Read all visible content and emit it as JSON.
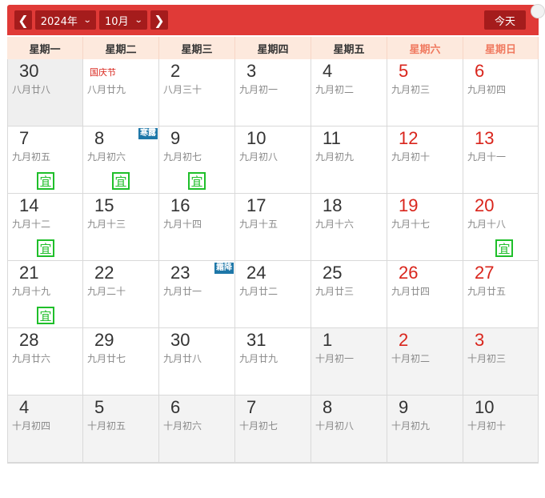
{
  "header": {
    "prev_icon": "chevron-left-icon",
    "next_icon": "chevron-right-icon",
    "year_value": "2024年",
    "month_value": "10月",
    "today_label": "今天"
  },
  "weekdays": [
    "星期一",
    "星期二",
    "星期三",
    "星期四",
    "星期五",
    "星期六",
    "星期日"
  ],
  "colors": {
    "header_bg": "#e03a37",
    "button_bg": "#a51c1c",
    "weekend_red": "#d9251c",
    "yi_green": "#1fbf2a",
    "term_blue": "#1e77a8"
  },
  "weeks": [
    [
      {
        "day": "30",
        "lunar": "八月廿八",
        "red": false,
        "month": "prev",
        "fest": "",
        "yi": false,
        "term": "",
        "gray": true
      },
      {
        "day": "",
        "lunar": "八月廿九",
        "red": false,
        "month": "cur",
        "fest": "国庆节",
        "yi": false,
        "term": ""
      },
      {
        "day": "2",
        "lunar": "八月三十",
        "red": false,
        "month": "cur",
        "fest": "",
        "yi": false,
        "term": ""
      },
      {
        "day": "3",
        "lunar": "九月初一",
        "red": false,
        "month": "cur",
        "fest": "",
        "yi": false,
        "term": ""
      },
      {
        "day": "4",
        "lunar": "九月初二",
        "red": false,
        "month": "cur",
        "fest": "",
        "yi": false,
        "term": ""
      },
      {
        "day": "5",
        "lunar": "九月初三",
        "red": true,
        "month": "cur",
        "fest": "",
        "yi": false,
        "term": ""
      },
      {
        "day": "6",
        "lunar": "九月初四",
        "red": true,
        "month": "cur",
        "fest": "",
        "yi": false,
        "term": ""
      }
    ],
    [
      {
        "day": "7",
        "lunar": "九月初五",
        "red": false,
        "month": "cur",
        "fest": "",
        "yi": true,
        "term": ""
      },
      {
        "day": "8",
        "lunar": "九月初六",
        "red": false,
        "month": "cur",
        "fest": "",
        "yi": true,
        "term": "寒露"
      },
      {
        "day": "9",
        "lunar": "九月初七",
        "red": false,
        "month": "cur",
        "fest": "",
        "yi": true,
        "term": ""
      },
      {
        "day": "10",
        "lunar": "九月初八",
        "red": false,
        "month": "cur",
        "fest": "",
        "yi": false,
        "term": ""
      },
      {
        "day": "11",
        "lunar": "九月初九",
        "red": false,
        "month": "cur",
        "fest": "",
        "yi": false,
        "term": ""
      },
      {
        "day": "12",
        "lunar": "九月初十",
        "red": true,
        "month": "cur",
        "fest": "",
        "yi": false,
        "term": ""
      },
      {
        "day": "13",
        "lunar": "九月十一",
        "red": true,
        "month": "cur",
        "fest": "",
        "yi": false,
        "term": ""
      }
    ],
    [
      {
        "day": "14",
        "lunar": "九月十二",
        "red": false,
        "month": "cur",
        "fest": "",
        "yi": true,
        "term": ""
      },
      {
        "day": "15",
        "lunar": "九月十三",
        "red": false,
        "month": "cur",
        "fest": "",
        "yi": false,
        "term": ""
      },
      {
        "day": "16",
        "lunar": "九月十四",
        "red": false,
        "month": "cur",
        "fest": "",
        "yi": false,
        "term": ""
      },
      {
        "day": "17",
        "lunar": "九月十五",
        "red": false,
        "month": "cur",
        "fest": "",
        "yi": false,
        "term": ""
      },
      {
        "day": "18",
        "lunar": "九月十六",
        "red": false,
        "month": "cur",
        "fest": "",
        "yi": false,
        "term": ""
      },
      {
        "day": "19",
        "lunar": "九月十七",
        "red": true,
        "month": "cur",
        "fest": "",
        "yi": false,
        "term": ""
      },
      {
        "day": "20",
        "lunar": "九月十八",
        "red": true,
        "month": "cur",
        "fest": "",
        "yi": true,
        "term": ""
      }
    ],
    [
      {
        "day": "21",
        "lunar": "九月十九",
        "red": false,
        "month": "cur",
        "fest": "",
        "yi": true,
        "term": ""
      },
      {
        "day": "22",
        "lunar": "九月二十",
        "red": false,
        "month": "cur",
        "fest": "",
        "yi": false,
        "term": ""
      },
      {
        "day": "23",
        "lunar": "九月廿一",
        "red": false,
        "month": "cur",
        "fest": "",
        "yi": false,
        "term": "霜降"
      },
      {
        "day": "24",
        "lunar": "九月廿二",
        "red": false,
        "month": "cur",
        "fest": "",
        "yi": false,
        "term": ""
      },
      {
        "day": "25",
        "lunar": "九月廿三",
        "red": false,
        "month": "cur",
        "fest": "",
        "yi": false,
        "term": ""
      },
      {
        "day": "26",
        "lunar": "九月廿四",
        "red": true,
        "month": "cur",
        "fest": "",
        "yi": false,
        "term": ""
      },
      {
        "day": "27",
        "lunar": "九月廿五",
        "red": true,
        "month": "cur",
        "fest": "",
        "yi": false,
        "term": ""
      }
    ],
    [
      {
        "day": "28",
        "lunar": "九月廿六",
        "red": false,
        "month": "cur",
        "fest": "",
        "yi": false,
        "term": ""
      },
      {
        "day": "29",
        "lunar": "九月廿七",
        "red": false,
        "month": "cur",
        "fest": "",
        "yi": false,
        "term": ""
      },
      {
        "day": "30",
        "lunar": "九月廿八",
        "red": false,
        "month": "cur",
        "fest": "",
        "yi": false,
        "term": ""
      },
      {
        "day": "31",
        "lunar": "九月廿九",
        "red": false,
        "month": "cur",
        "fest": "",
        "yi": false,
        "term": ""
      },
      {
        "day": "1",
        "lunar": "十月初一",
        "red": false,
        "month": "next",
        "fest": "",
        "yi": false,
        "term": ""
      },
      {
        "day": "2",
        "lunar": "十月初二",
        "red": true,
        "month": "next",
        "fest": "",
        "yi": false,
        "term": ""
      },
      {
        "day": "3",
        "lunar": "十月初三",
        "red": true,
        "month": "next",
        "fest": "",
        "yi": false,
        "term": ""
      }
    ],
    [
      {
        "day": "4",
        "lunar": "十月初四",
        "red": false,
        "month": "next",
        "fest": "",
        "yi": false,
        "term": ""
      },
      {
        "day": "5",
        "lunar": "十月初五",
        "red": false,
        "month": "next",
        "fest": "",
        "yi": false,
        "term": ""
      },
      {
        "day": "6",
        "lunar": "十月初六",
        "red": false,
        "month": "next",
        "fest": "",
        "yi": false,
        "term": ""
      },
      {
        "day": "7",
        "lunar": "十月初七",
        "red": false,
        "month": "next",
        "fest": "",
        "yi": false,
        "term": ""
      },
      {
        "day": "8",
        "lunar": "十月初八",
        "red": false,
        "month": "next",
        "fest": "",
        "yi": false,
        "term": ""
      },
      {
        "day": "9",
        "lunar": "十月初九",
        "red": false,
        "month": "next",
        "fest": "",
        "yi": false,
        "term": ""
      },
      {
        "day": "10",
        "lunar": "十月初十",
        "red": false,
        "month": "next",
        "fest": "",
        "yi": false,
        "term": ""
      }
    ]
  ],
  "yi_label": "宜"
}
